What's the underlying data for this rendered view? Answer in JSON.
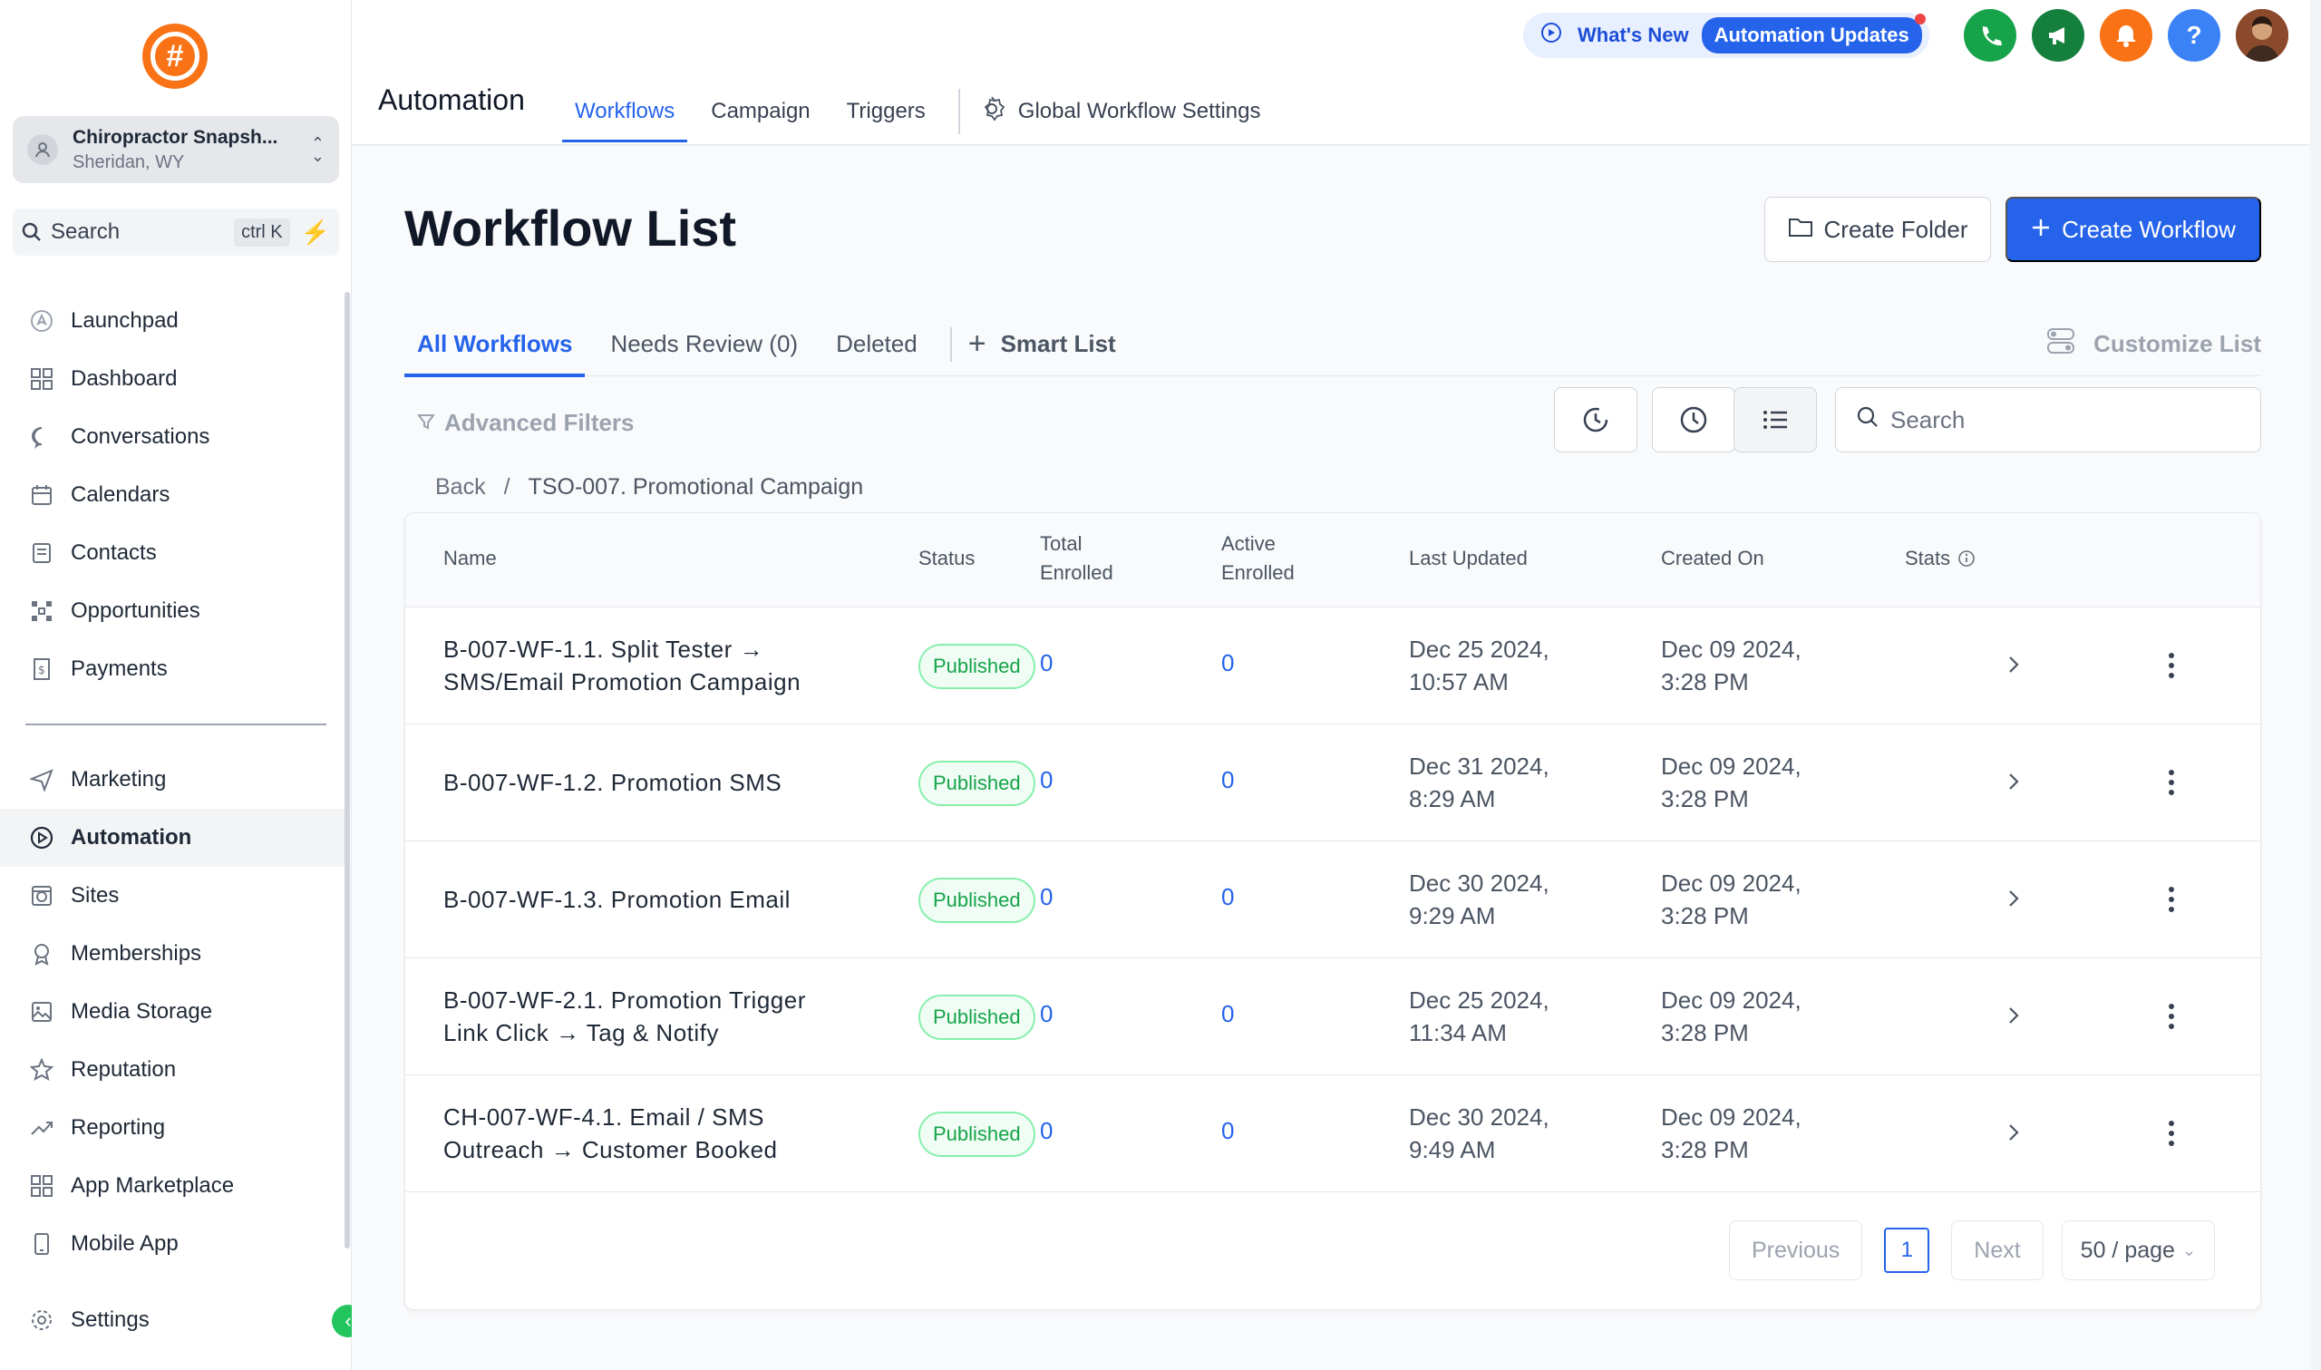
{
  "sidebar": {
    "logo_glyph": "#",
    "account": {
      "name": "Chiropractor Snapsh...",
      "location": "Sheridan, WY"
    },
    "search": {
      "label": "Search",
      "shortcut": "ctrl K"
    },
    "nav_top": [
      {
        "label": "Launchpad",
        "icon": "rocket-icon"
      },
      {
        "label": "Dashboard",
        "icon": "grid-icon"
      },
      {
        "label": "Conversations",
        "icon": "chat-icon"
      },
      {
        "label": "Calendars",
        "icon": "calendar-icon"
      },
      {
        "label": "Contacts",
        "icon": "contacts-icon"
      },
      {
        "label": "Opportunities",
        "icon": "pipeline-icon"
      },
      {
        "label": "Payments",
        "icon": "receipt-icon"
      }
    ],
    "nav_bottom": [
      {
        "label": "Marketing",
        "icon": "send-icon"
      },
      {
        "label": "Automation",
        "icon": "automation-icon",
        "active": true
      },
      {
        "label": "Sites",
        "icon": "globe-icon"
      },
      {
        "label": "Memberships",
        "icon": "award-icon"
      },
      {
        "label": "Media Storage",
        "icon": "image-icon"
      },
      {
        "label": "Reputation",
        "icon": "star-icon"
      },
      {
        "label": "Reporting",
        "icon": "trend-icon"
      },
      {
        "label": "App Marketplace",
        "icon": "apps-icon"
      },
      {
        "label": "Mobile App",
        "icon": "phone-icon"
      }
    ],
    "settings_label": "Settings"
  },
  "topbar": {
    "section_title": "Automation",
    "tabs": [
      "Workflows",
      "Campaign",
      "Triggers"
    ],
    "active_tab": "Workflows",
    "global_settings": "Global Workflow Settings",
    "whats_new": "What's New",
    "updates_pill": "Automation Updates",
    "help_glyph": "?"
  },
  "main": {
    "title": "Workflow List",
    "create_folder": "Create Folder",
    "create_workflow": "Create Workflow",
    "list_tabs": [
      "All Workflows",
      "Needs Review (0)",
      "Deleted"
    ],
    "smart_list": "Smart List",
    "customize_list": "Customize List",
    "advanced_filters": "Advanced Filters",
    "search_placeholder": "Search",
    "breadcrumb": {
      "back": "Back",
      "separator": "/",
      "current": "TSO-007. Promotional Campaign"
    }
  },
  "table": {
    "headers": {
      "name": "Name",
      "status": "Status",
      "total_1": "Total",
      "total_2": "Enrolled",
      "active_1": "Active",
      "active_2": "Enrolled",
      "last_updated": "Last Updated",
      "created_on": "Created On",
      "stats": "Stats"
    },
    "rows": [
      {
        "name_1": "B-007-WF-1.1. Split Tester →",
        "name_2": "SMS/Email Promotion Campaign",
        "status": "Published",
        "total": "0",
        "active": "0",
        "updated_1": "Dec 25 2024,",
        "updated_2": "10:57 AM",
        "created_1": "Dec 09 2024,",
        "created_2": "3:28 PM"
      },
      {
        "name_1": "B-007-WF-1.2. Promotion SMS",
        "name_2": "",
        "status": "Published",
        "total": "0",
        "active": "0",
        "updated_1": "Dec 31 2024,",
        "updated_2": "8:29 AM",
        "created_1": "Dec 09 2024,",
        "created_2": "3:28 PM"
      },
      {
        "name_1": "B-007-WF-1.3. Promotion Email",
        "name_2": "",
        "status": "Published",
        "total": "0",
        "active": "0",
        "updated_1": "Dec 30 2024,",
        "updated_2": "9:29 AM",
        "created_1": "Dec 09 2024,",
        "created_2": "3:28 PM"
      },
      {
        "name_1": "B-007-WF-2.1. Promotion Trigger",
        "name_2": "Link Click → Tag & Notify",
        "status": "Published",
        "total": "0",
        "active": "0",
        "updated_1": "Dec 25 2024,",
        "updated_2": "11:34 AM",
        "created_1": "Dec 09 2024,",
        "created_2": "3:28 PM"
      },
      {
        "name_1": "CH-007-WF-4.1. Email / SMS",
        "name_2": "Outreach → Customer Booked",
        "status": "Published",
        "total": "0",
        "active": "0",
        "updated_1": "Dec 30 2024,",
        "updated_2": "9:49 AM",
        "created_1": "Dec 09 2024,",
        "created_2": "3:28 PM"
      }
    ]
  },
  "pagination": {
    "previous": "Previous",
    "page": "1",
    "next": "Next",
    "page_size": "50 / page"
  },
  "colors": {
    "accent": "#2563eb",
    "success": "#16a34a",
    "brand": "#f97316"
  }
}
